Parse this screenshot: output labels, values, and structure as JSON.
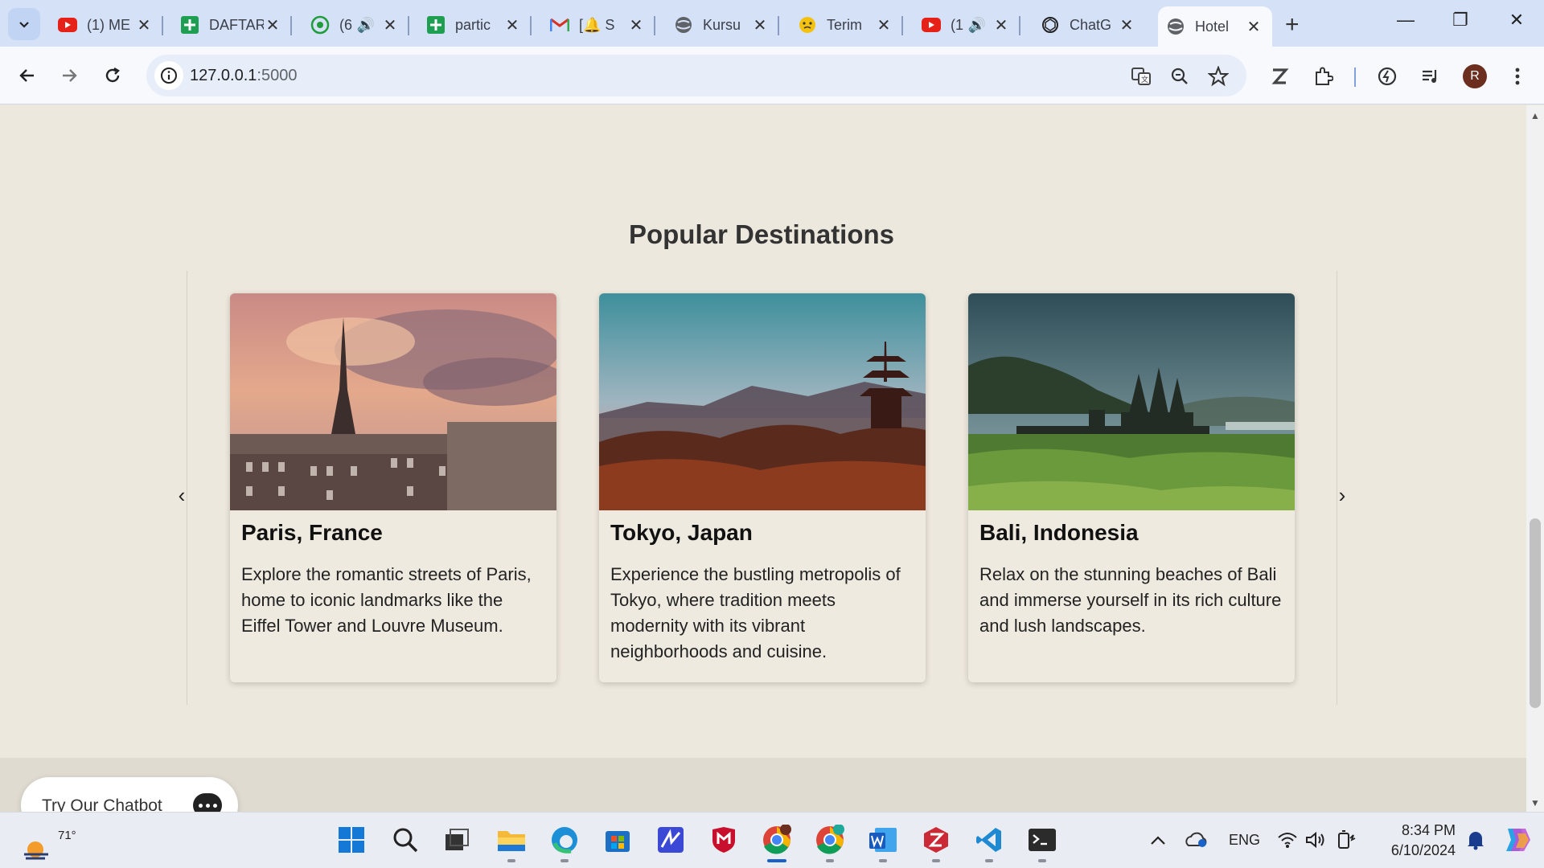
{
  "browser": {
    "tabs": [
      {
        "title": "(1) ME",
        "icon": "youtube-icon"
      },
      {
        "title": "DAFTAR",
        "icon": "sheets-icon"
      },
      {
        "title": "(6",
        "icon": "whatsapp-icon"
      },
      {
        "title": "partic",
        "icon": "sheets-icon"
      },
      {
        "title": "[🔔 S",
        "icon": "gmail-icon"
      },
      {
        "title": "Kursu",
        "icon": "globe-icon"
      },
      {
        "title": "Terim",
        "icon": "emoji-icon"
      },
      {
        "title": "(1",
        "icon": "youtube-icon"
      },
      {
        "title": "ChatG",
        "icon": "chatgpt-icon"
      },
      {
        "title": "Hotel",
        "icon": "globe-icon"
      }
    ],
    "address": {
      "host": "127.0.0.1",
      "port": ":5000"
    },
    "profile_initial": "R"
  },
  "page": {
    "section_title": "Popular Destinations",
    "prev_arrow": "‹",
    "next_arrow": "›",
    "destinations": [
      {
        "name": "Paris, France",
        "description": "Explore the romantic streets of Paris, home to iconic landmarks like the Eiffel Tower and Louvre Museum."
      },
      {
        "name": "Tokyo, Japan",
        "description": "Experience the bustling metropolis of Tokyo, where tradition meets modernity with its vibrant neighborhoods and cuisine."
      },
      {
        "name": "Bali, Indonesia",
        "description": "Relax on the stunning beaches of Bali and immerse yourself in its rich culture and lush landscapes."
      }
    ],
    "chatbot_label": "Try Our Chatbot"
  },
  "taskbar": {
    "weather_temp": "71°",
    "language": "ENG",
    "time": "8:34 PM",
    "date": "6/10/2024"
  },
  "colors": {
    "accent": "#1a62c8",
    "page_bg": "#ede8dd",
    "tab_strip": "#d5e1f7"
  }
}
